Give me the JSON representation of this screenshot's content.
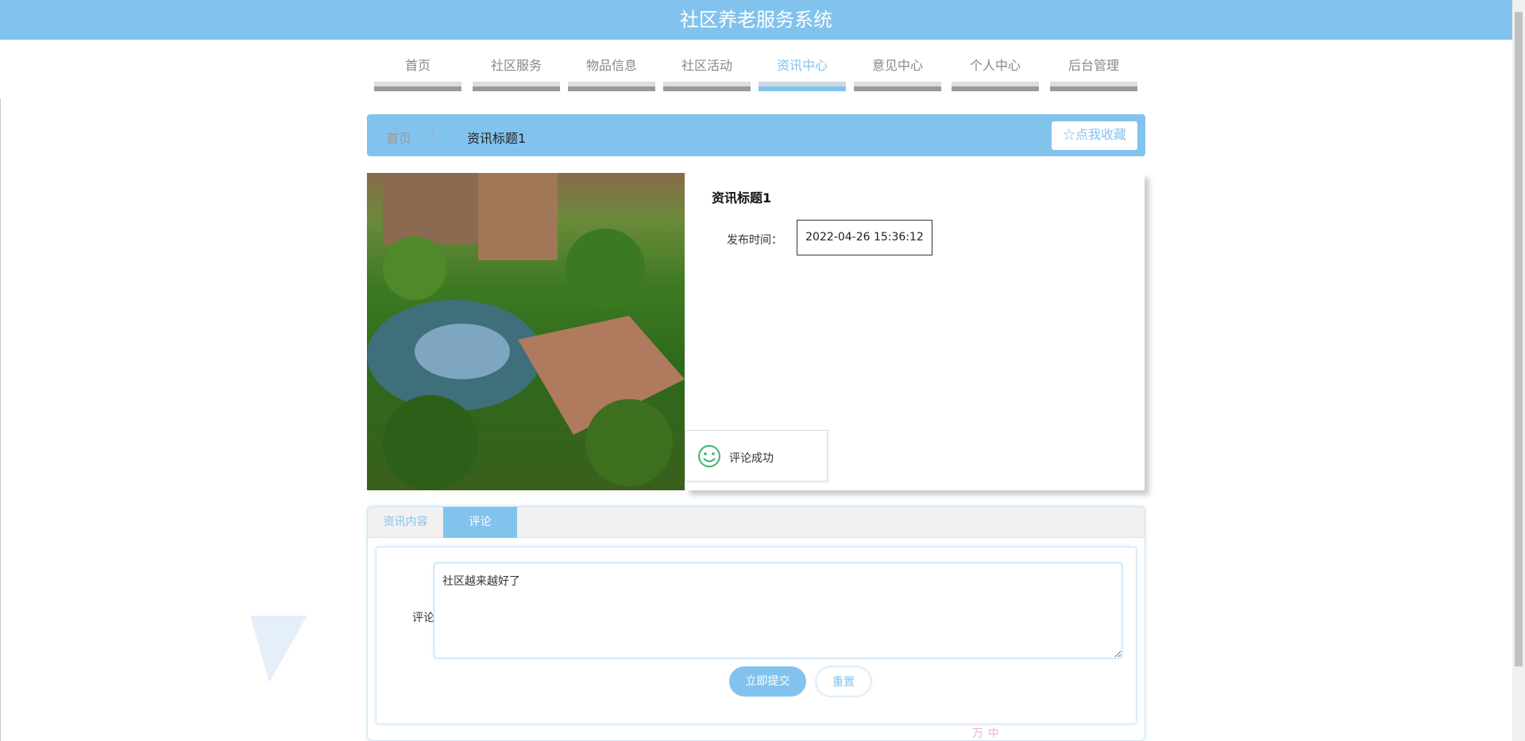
{
  "header": {
    "title": "社区养老服务系统"
  },
  "nav": {
    "items": [
      {
        "label": "首页"
      },
      {
        "label": "社区服务"
      },
      {
        "label": "物品信息"
      },
      {
        "label": "社区活动"
      },
      {
        "label": "资讯中心",
        "active": true
      },
      {
        "label": "意见中心"
      },
      {
        "label": "个人中心"
      },
      {
        "label": "后台管理"
      }
    ]
  },
  "breadcrumb": {
    "home": "首页",
    "separator": "/",
    "current": "资讯标题1",
    "favorite_label": "☆点我收藏"
  },
  "detail": {
    "title": "资讯标题1",
    "publish_label": "发布时间：",
    "publish_time": "2022-04-26 15:36:12"
  },
  "toast": {
    "message": "评论成功"
  },
  "tabs": [
    {
      "label": "资讯内容"
    },
    {
      "label": "评论",
      "active": true
    }
  ],
  "comment_form": {
    "label": "评论",
    "value": "社区越来越好了",
    "submit": "立即提交",
    "reset": "重置"
  },
  "ime_toolbar": "万中"
}
